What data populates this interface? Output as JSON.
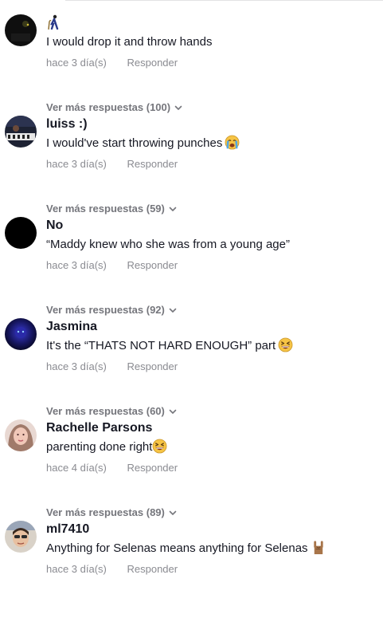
{
  "comments": [
    {
      "username": "",
      "username_emoji": "person-with-cane-emoji",
      "text": "I would drop it and throw hands",
      "text_emoji": "",
      "time": "hace 3 día(s)",
      "reply_label": "Responder",
      "more_replies": "Ver más respuestas (100)"
    },
    {
      "username": "luiss :)",
      "text": "I would've start throwing punches",
      "text_emoji": "crying-face-emoji",
      "time": "hace 3 día(s)",
      "reply_label": "Responder",
      "more_replies": "Ver más respuestas (59)"
    },
    {
      "username": "No",
      "text": "“Maddy knew who she was from a young age”",
      "text_emoji": "",
      "time": "hace 3 día(s)",
      "reply_label": "Responder",
      "more_replies": "Ver más respuestas (92)"
    },
    {
      "username": "Jasmina",
      "text": "It's the “THATS NOT HARD ENOUGH” part",
      "text_emoji": "grinning-squinting-face-emoji",
      "time": "hace 3 día(s)",
      "reply_label": "Responder",
      "more_replies": "Ver más respuestas (60)"
    },
    {
      "username": "Rachelle Parsons",
      "text": "parenting done right",
      "text_emoji": "grinning-squinting-face-emoji",
      "time": "hace 4 día(s)",
      "reply_label": "Responder",
      "more_replies": "Ver más respuestas (89)"
    },
    {
      "username": "ml7410",
      "text": "Anything for Selenas means anything for Selenas",
      "text_emoji": "sign-of-horns-emoji",
      "time": "hace 3 día(s)",
      "reply_label": "Responder",
      "more_replies": ""
    }
  ],
  "colors": {
    "text_primary": "#161823",
    "text_secondary": "#8a8b91",
    "more_replies": "#75767c"
  }
}
